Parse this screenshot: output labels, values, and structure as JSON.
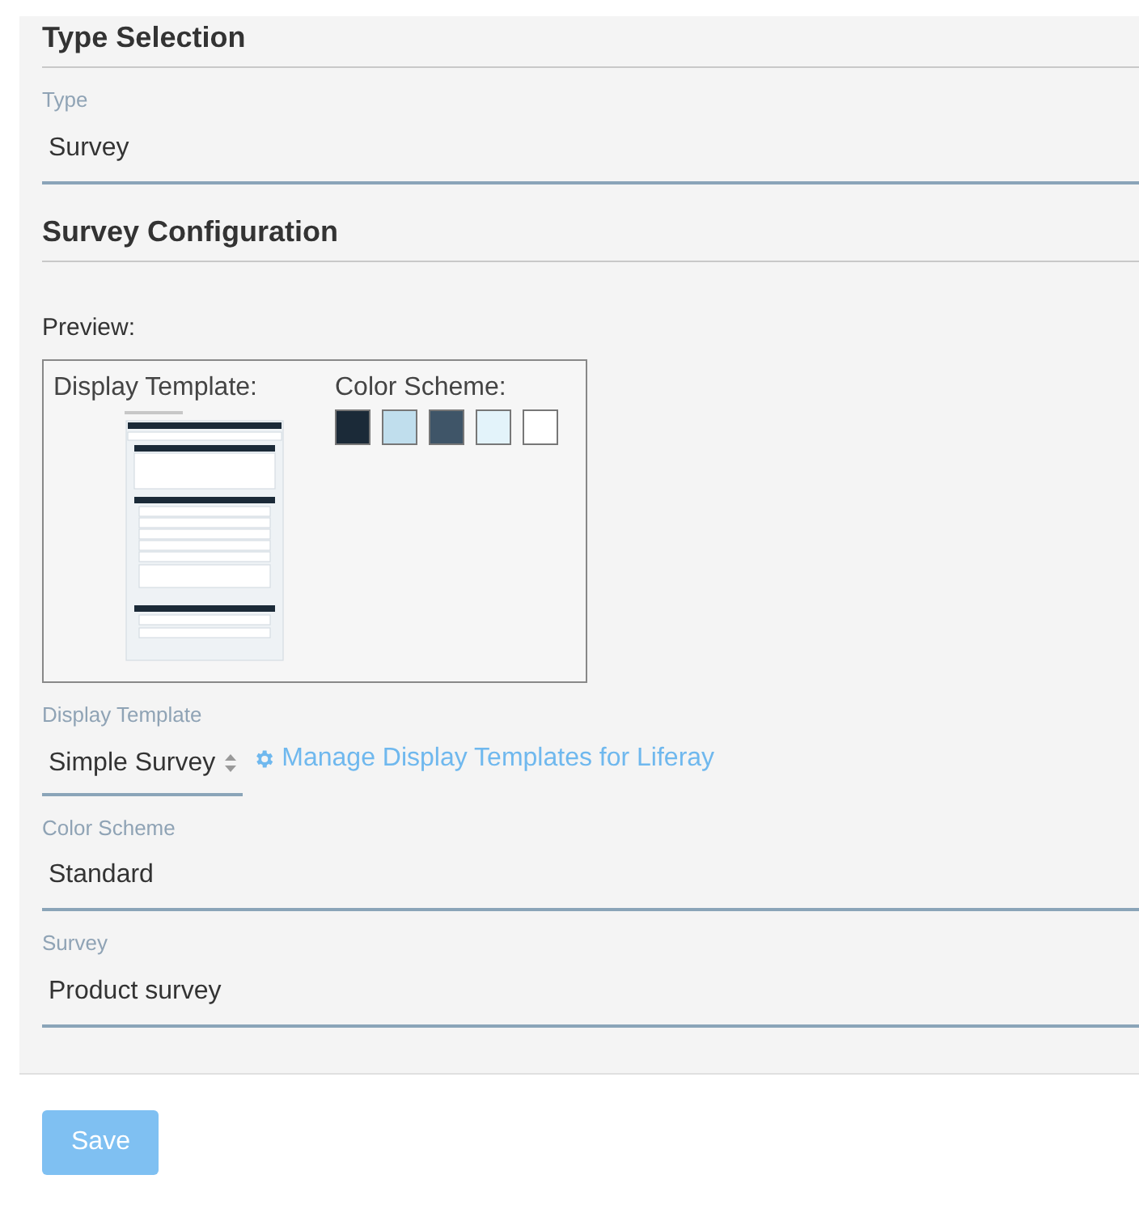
{
  "sections": [
    {
      "title": "Type Selection",
      "fields": [
        {
          "kind": "text",
          "label": "Type",
          "value": "Survey"
        }
      ]
    },
    {
      "title": "Survey Configuration",
      "preview": {
        "label": "Preview:",
        "template_label": "Display Template:",
        "scheme_label": "Color Scheme:",
        "swatches": [
          {
            "color": "#1b2a38"
          },
          {
            "color": "#c0deed"
          },
          {
            "color": "#3f5568"
          },
          {
            "color": "#e3f3fa"
          },
          {
            "color": "#ffffff"
          }
        ]
      },
      "fields": [
        {
          "kind": "select",
          "label": "Display Template",
          "value": "Simple Survey",
          "link": "Manage Display Templates for Liferay"
        },
        {
          "kind": "text",
          "label": "Color Scheme",
          "value": "Standard"
        },
        {
          "kind": "text",
          "label": "Survey",
          "value": "Product survey"
        }
      ]
    }
  ],
  "save_button": {
    "label": "Save",
    "disabled": true
  }
}
